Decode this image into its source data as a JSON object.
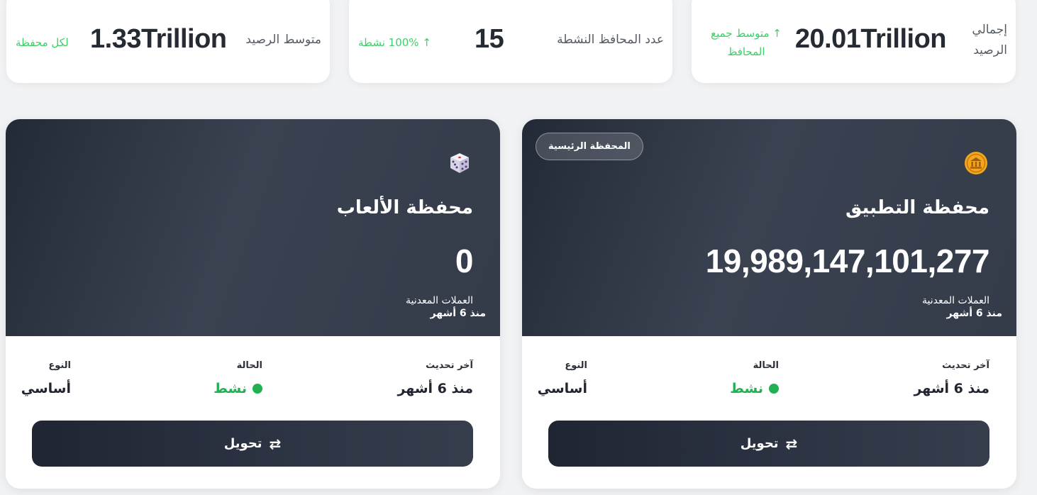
{
  "stats": {
    "total": {
      "label": "إجمالي الرصيد",
      "value": "20.01Trillion",
      "trend": "↑ متوسط جميع المحافظ"
    },
    "active": {
      "label": "عدد المحافظ النشطة",
      "value": "15",
      "trend": "↑ 100% نشطة"
    },
    "average": {
      "label": "متوسط الرصيد",
      "value": "1.33Trillion",
      "trend": "لكل محفظة"
    }
  },
  "wallets": [
    {
      "badge": "المحفظة الرئيسية",
      "icon": "bank-coin-icon",
      "name": "محفظة التطبيق",
      "balance": "19,989,147,101,277",
      "currency": "العملات المعدنية",
      "since": "منذ 6 أشهر",
      "info": {
        "updated_label": "آخر تحديث",
        "updated_value": "منذ 6 أشهر",
        "status_label": "الحالة",
        "status_value": "نشط",
        "type_label": "النوع",
        "type_value": "أساسي"
      },
      "transfer_label": "تحويل"
    },
    {
      "icon": "dice-icon",
      "name": "محفظة الألعاب",
      "balance": "0",
      "currency": "العملات المعدنية",
      "since": "منذ 6 أشهر",
      "info": {
        "updated_label": "آخر تحديث",
        "updated_value": "منذ 6 أشهر",
        "status_label": "الحالة",
        "status_value": "نشط",
        "type_label": "النوع",
        "type_value": "أساسي"
      },
      "transfer_label": "تحويل"
    }
  ],
  "colors": {
    "accent_green": "#21b052",
    "trend_green": "#3ecf6a",
    "header_dark": "#2f3644",
    "coin_gold": "#f3a71c"
  }
}
